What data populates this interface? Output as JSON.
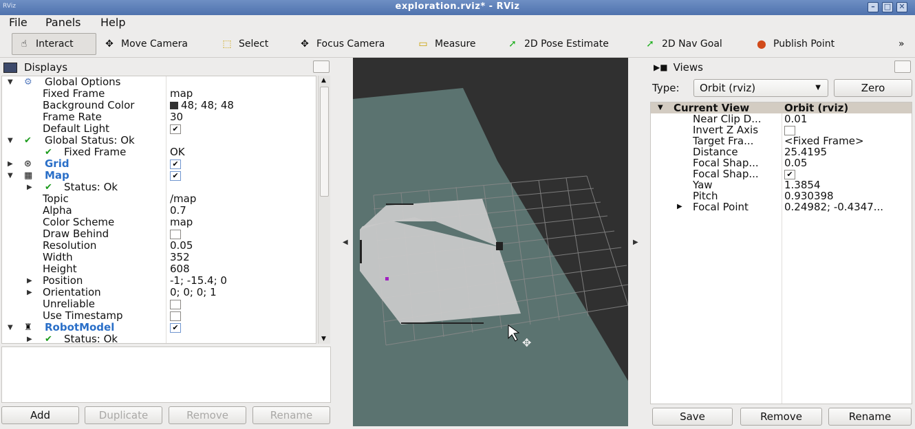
{
  "window": {
    "title": "exploration.rviz* - RViz",
    "app_mini": "RViz"
  },
  "menu": [
    "File",
    "Panels",
    "Help"
  ],
  "toolbar": {
    "tools": [
      {
        "label": "Interact",
        "icon": "hand-pointer-icon",
        "glyph": "☝"
      },
      {
        "label": "Move Camera",
        "icon": "move-camera-icon",
        "glyph": "✥"
      },
      {
        "label": "Select",
        "icon": "select-box-icon",
        "glyph": "⬚"
      },
      {
        "label": "Focus Camera",
        "icon": "focus-camera-icon",
        "glyph": "✥"
      },
      {
        "label": "Measure",
        "icon": "ruler-icon",
        "glyph": "▭"
      },
      {
        "label": "2D Pose Estimate",
        "icon": "pose-arrow-icon",
        "glyph": "➚"
      },
      {
        "label": "2D Nav Goal",
        "icon": "nav-goal-arrow-icon",
        "glyph": "➚"
      },
      {
        "label": "Publish Point",
        "icon": "map-pin-icon",
        "glyph": "⬤"
      }
    ],
    "overflow": "»"
  },
  "displays": {
    "title": "Displays",
    "rows": [
      {
        "label": "Global Options",
        "value": ""
      },
      {
        "label": "Fixed Frame",
        "value": "map"
      },
      {
        "label": "Background Color",
        "value": "48; 48; 48"
      },
      {
        "label": "Frame Rate",
        "value": "30"
      },
      {
        "label": "Default Light",
        "value": ""
      },
      {
        "label": "Global Status: Ok",
        "value": ""
      },
      {
        "label": "Fixed Frame",
        "value": "OK"
      },
      {
        "label": "Grid",
        "value": ""
      },
      {
        "label": "Map",
        "value": ""
      },
      {
        "label": "Status: Ok",
        "value": ""
      },
      {
        "label": "Topic",
        "value": "/map"
      },
      {
        "label": "Alpha",
        "value": "0.7"
      },
      {
        "label": "Color Scheme",
        "value": "map"
      },
      {
        "label": "Draw Behind",
        "value": ""
      },
      {
        "label": "Resolution",
        "value": "0.05"
      },
      {
        "label": "Width",
        "value": "352"
      },
      {
        "label": "Height",
        "value": "608"
      },
      {
        "label": "Position",
        "value": "-1; -15.4; 0"
      },
      {
        "label": "Orientation",
        "value": "0; 0; 0; 1"
      },
      {
        "label": "Unreliable",
        "value": ""
      },
      {
        "label": "Use Timestamp",
        "value": ""
      },
      {
        "label": "RobotModel",
        "value": ""
      },
      {
        "label": "Status: Ok",
        "value": ""
      }
    ],
    "buttons": {
      "add": "Add",
      "duplicate": "Duplicate",
      "remove": "Remove",
      "rename": "Rename"
    }
  },
  "views": {
    "title": "Views",
    "type_label": "Type:",
    "type_value": "Orbit (rviz)",
    "zero": "Zero",
    "header": {
      "label": "Current View",
      "value": "Orbit (rviz)"
    },
    "rows": [
      {
        "label": "Near Clip D...",
        "value": "0.01"
      },
      {
        "label": "Invert Z Axis",
        "value": ""
      },
      {
        "label": "Target Fra...",
        "value": "<Fixed Frame>"
      },
      {
        "label": "Distance",
        "value": "25.4195"
      },
      {
        "label": "Focal Shap...",
        "value": "0.05"
      },
      {
        "label": "Focal Shap...",
        "value": ""
      },
      {
        "label": "Yaw",
        "value": "1.3854"
      },
      {
        "label": "Pitch",
        "value": "0.930398"
      },
      {
        "label": "Focal Point",
        "value": "0.24982; -0.4347..."
      }
    ],
    "buttons": {
      "save": "Save",
      "remove": "Remove",
      "rename": "Rename"
    }
  },
  "colors": {
    "background": "#303030",
    "ground_plane": "#5b7370",
    "map_free": "#c8c8c8"
  }
}
